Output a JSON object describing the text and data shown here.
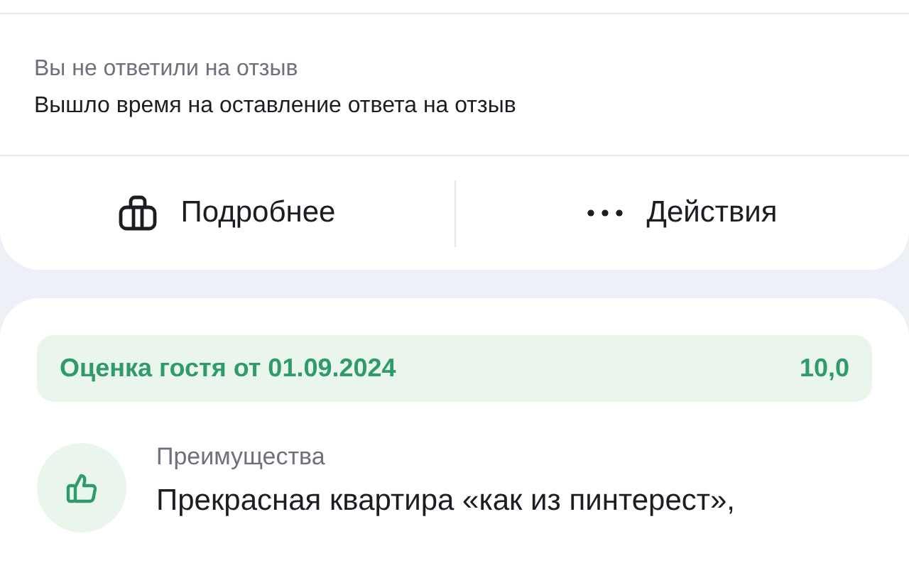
{
  "reply_status": {
    "title": "Вы не ответили на отзыв",
    "message": "Вышло время на оставление ответа на отзыв"
  },
  "actions": [
    {
      "kind": "details",
      "label": "Подробнее"
    },
    {
      "kind": "more",
      "label": "Действия"
    }
  ],
  "review": {
    "rating_banner": {
      "label": "Оценка гостя от 01.09.2024",
      "score": "10,0"
    },
    "sections": [
      {
        "kind": "pros",
        "title": "Преимущества",
        "text": "Прекрасная квартира «как из пинтерест»,"
      }
    ]
  }
}
